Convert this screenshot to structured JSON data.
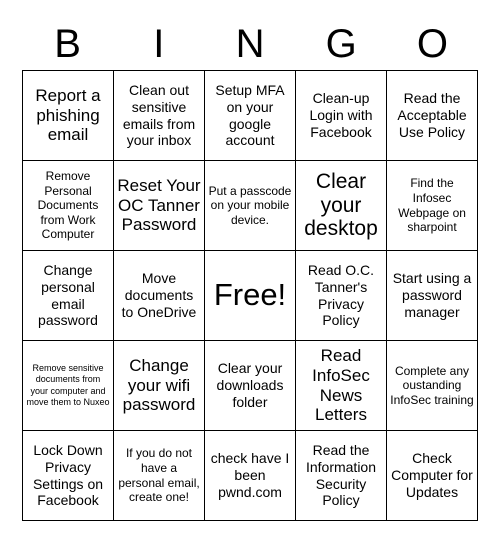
{
  "card": {
    "header_letters": [
      "B",
      "I",
      "N",
      "G",
      "O"
    ],
    "rows": [
      [
        {
          "text": "Report a phishing email",
          "size": "l"
        },
        {
          "text": "Clean out sensitive emails from your inbox",
          "size": "m"
        },
        {
          "text": "Setup MFA on your google account",
          "size": "m"
        },
        {
          "text": "Clean-up Login with Facebook",
          "size": "m"
        },
        {
          "text": "Read the Acceptable Use Policy",
          "size": "m"
        }
      ],
      [
        {
          "text": "Remove Personal Documents from Work Computer",
          "size": "s"
        },
        {
          "text": "Reset Your OC Tanner Password",
          "size": "l"
        },
        {
          "text": "Put a passcode on your mobile device.",
          "size": "s"
        },
        {
          "text": "Clear your desktop",
          "size": "xl"
        },
        {
          "text": "Find the Infosec Webpage on sharpoint",
          "size": "s"
        }
      ],
      [
        {
          "text": "Change personal email password",
          "size": "m"
        },
        {
          "text": "Move documents to OneDrive",
          "size": "m"
        },
        {
          "text": "Free!",
          "size": "free"
        },
        {
          "text": "Read O.C. Tanner's Privacy Policy",
          "size": "m"
        },
        {
          "text": "Start using a password manager",
          "size": "m"
        }
      ],
      [
        {
          "text": "Remove sensitive documents from your computer and move them to Nuxeo",
          "size": "xs"
        },
        {
          "text": "Change your wifi password",
          "size": "l"
        },
        {
          "text": "Clear your downloads folder",
          "size": "m"
        },
        {
          "text": "Read InfoSec News Letters",
          "size": "l"
        },
        {
          "text": "Complete any oustanding InfoSec training",
          "size": "s"
        }
      ],
      [
        {
          "text": "Lock Down Privacy Settings on Facebook",
          "size": "m"
        },
        {
          "text": "If you do not have a personal email, create one!",
          "size": "s"
        },
        {
          "text": "check have I been pwnd.com",
          "size": "m"
        },
        {
          "text": "Read the Information Security Policy",
          "size": "m"
        },
        {
          "text": "Check Computer for Updates",
          "size": "m"
        }
      ]
    ]
  },
  "colors": {
    "background": "#ffffff",
    "text": "#000000",
    "border": "#000000"
  }
}
